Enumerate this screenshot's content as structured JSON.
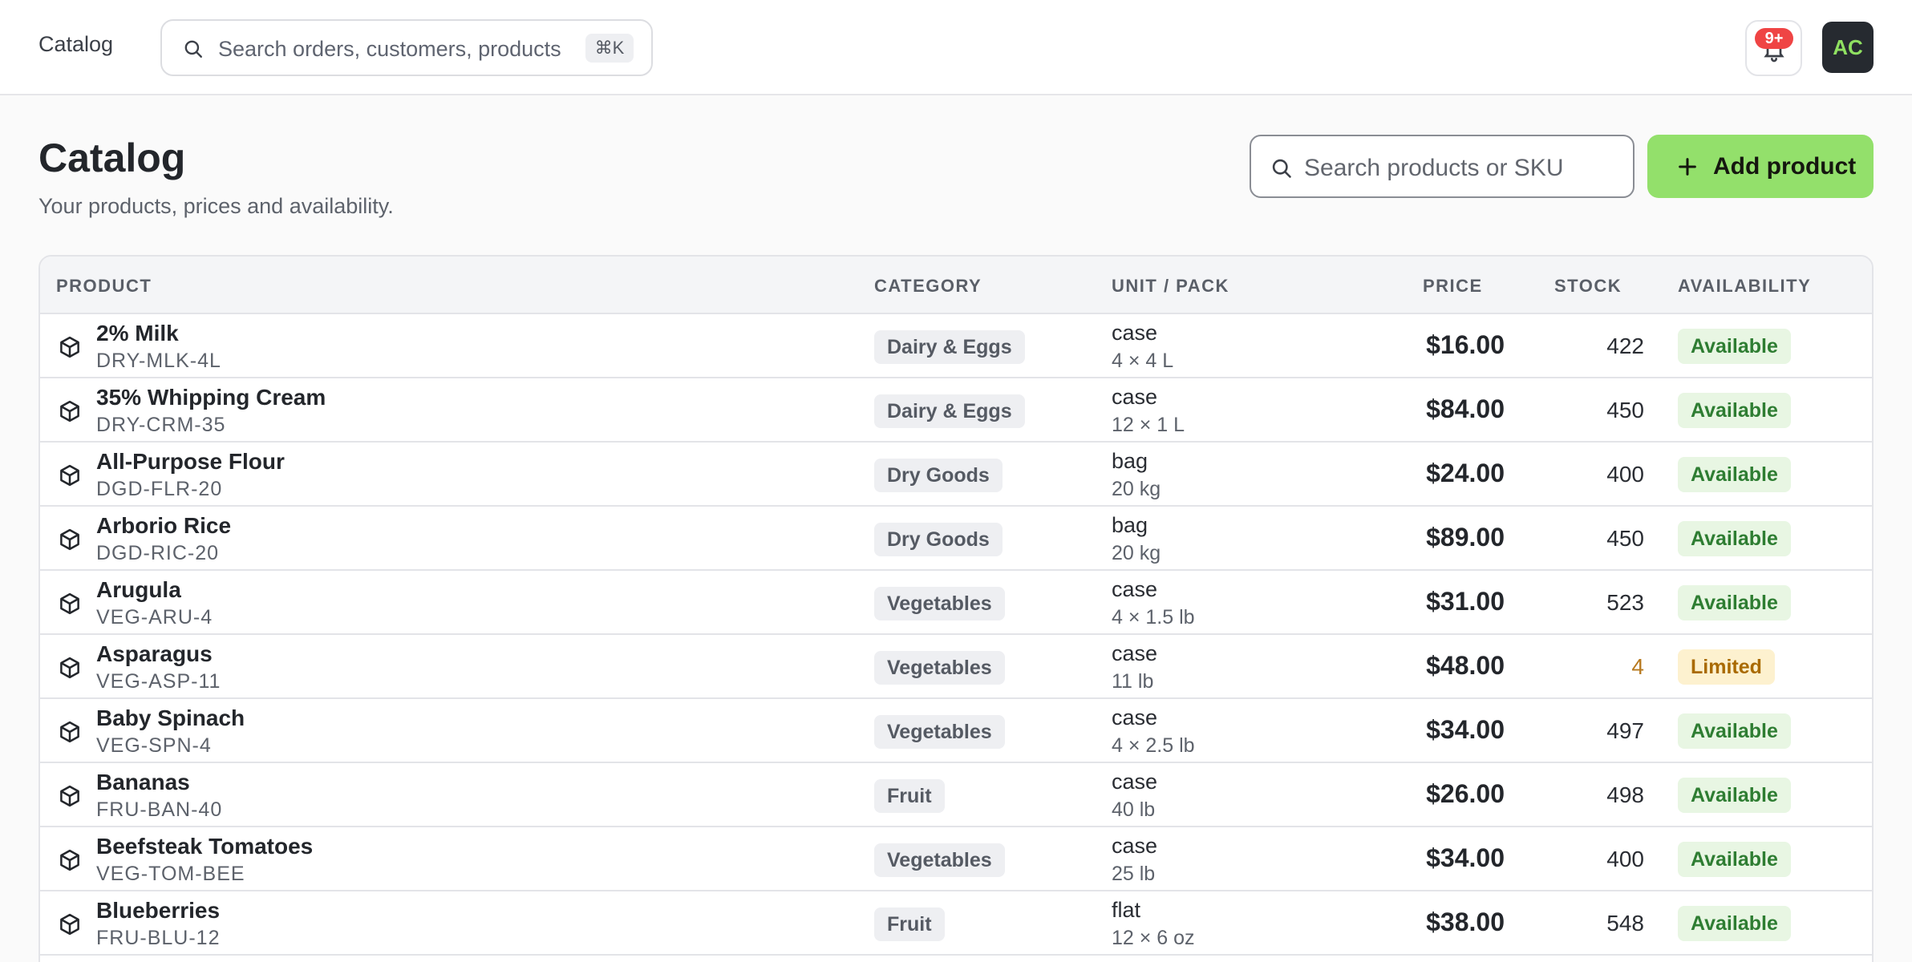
{
  "topbar": {
    "brand": "Catalog",
    "search_placeholder": "Search orders, customers, products",
    "search_shortcut": "⌘K",
    "notifications_badge": "9+",
    "avatar_initials": "AC"
  },
  "header": {
    "title": "Catalog",
    "subtitle": "Your products, prices and availability.",
    "search_placeholder": "Search products or SKU",
    "add_button": "Add product"
  },
  "table": {
    "columns": [
      "PRODUCT",
      "CATEGORY",
      "UNIT / PACK",
      "PRICE",
      "STOCK",
      "AVAILABILITY"
    ],
    "rows": [
      {
        "name": "2% Milk",
        "sku": "DRY-MLK-4L",
        "category": "Dairy & Eggs",
        "unit": "case",
        "pack": "4 × 4 L",
        "price": "$16.00",
        "stock": "422",
        "availability": "Available",
        "status": "available"
      },
      {
        "name": "35% Whipping Cream",
        "sku": "DRY-CRM-35",
        "category": "Dairy & Eggs",
        "unit": "case",
        "pack": "12 × 1 L",
        "price": "$84.00",
        "stock": "450",
        "availability": "Available",
        "status": "available"
      },
      {
        "name": "All-Purpose Flour",
        "sku": "DGD-FLR-20",
        "category": "Dry Goods",
        "unit": "bag",
        "pack": "20 kg",
        "price": "$24.00",
        "stock": "400",
        "availability": "Available",
        "status": "available"
      },
      {
        "name": "Arborio Rice",
        "sku": "DGD-RIC-20",
        "category": "Dry Goods",
        "unit": "bag",
        "pack": "20 kg",
        "price": "$89.00",
        "stock": "450",
        "availability": "Available",
        "status": "available"
      },
      {
        "name": "Arugula",
        "sku": "VEG-ARU-4",
        "category": "Vegetables",
        "unit": "case",
        "pack": "4 × 1.5 lb",
        "price": "$31.00",
        "stock": "523",
        "availability": "Available",
        "status": "available"
      },
      {
        "name": "Asparagus",
        "sku": "VEG-ASP-11",
        "category": "Vegetables",
        "unit": "case",
        "pack": "11 lb",
        "price": "$48.00",
        "stock": "4",
        "availability": "Limited",
        "status": "limited"
      },
      {
        "name": "Baby Spinach",
        "sku": "VEG-SPN-4",
        "category": "Vegetables",
        "unit": "case",
        "pack": "4 × 2.5 lb",
        "price": "$34.00",
        "stock": "497",
        "availability": "Available",
        "status": "available"
      },
      {
        "name": "Bananas",
        "sku": "FRU-BAN-40",
        "category": "Fruit",
        "unit": "case",
        "pack": "40 lb",
        "price": "$26.00",
        "stock": "498",
        "availability": "Available",
        "status": "available"
      },
      {
        "name": "Beefsteak Tomatoes",
        "sku": "VEG-TOM-BEE",
        "category": "Vegetables",
        "unit": "case",
        "pack": "25 lb",
        "price": "$34.00",
        "stock": "400",
        "availability": "Available",
        "status": "available"
      },
      {
        "name": "Blueberries",
        "sku": "FRU-BLU-12",
        "category": "Fruit",
        "unit": "flat",
        "pack": "12 × 6 oz",
        "price": "$38.00",
        "stock": "548",
        "availability": "Available",
        "status": "available"
      }
    ]
  }
}
